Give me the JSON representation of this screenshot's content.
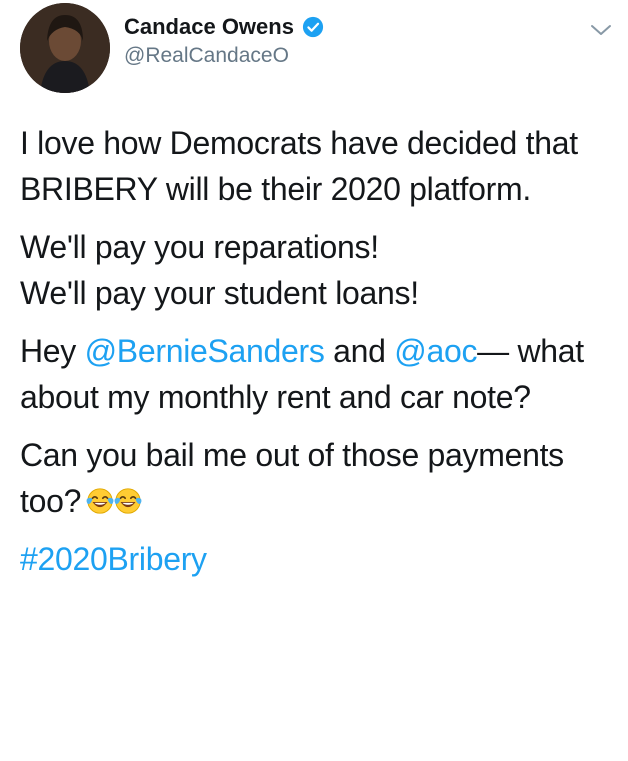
{
  "author": {
    "name": "Candace Owens",
    "handle": "@RealCandaceO",
    "verified": true
  },
  "tweet": {
    "p1": "I love how Democrats have decided that BRIBERY will be their 2020 platform.",
    "p2_line1": "We'll pay you reparations!",
    "p2_line2": "We'll pay your student loans!",
    "p3_prefix": "Hey ",
    "mention1": "@BernieSanders",
    "p3_and": " and ",
    "mention2": "@aoc",
    "p3_suffix": "— what about my monthly rent and car note?",
    "p4": "Can you bail me out of those payments too?",
    "emojis": [
      "face-with-tears-of-joy",
      "face-with-tears-of-joy"
    ],
    "hashtag": "#2020Bribery"
  },
  "colors": {
    "link": "#1da1f2",
    "text": "#14171a",
    "secondary": "#657786"
  }
}
